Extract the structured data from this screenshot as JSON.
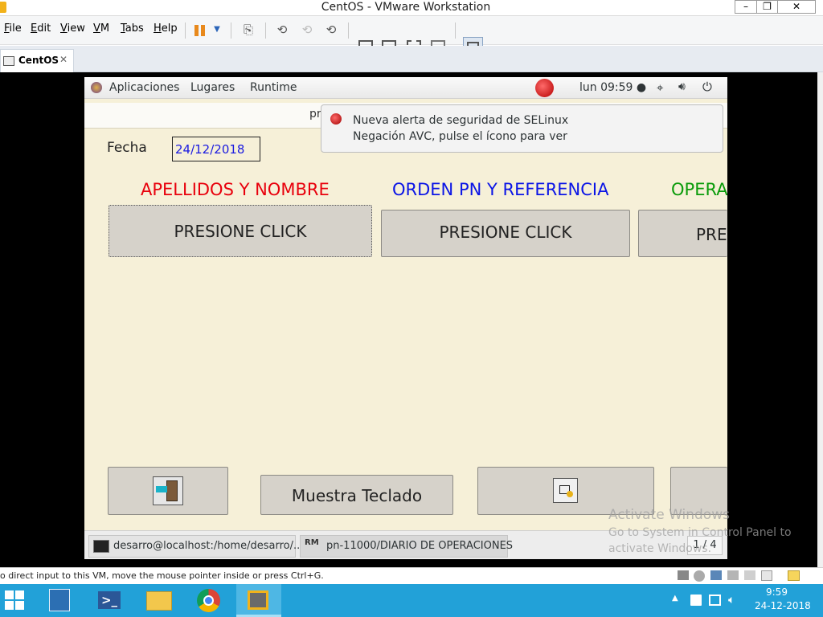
{
  "window": {
    "title": "CentOS - VMware Workstation",
    "minimize": "–",
    "maximize": "❐",
    "close": "✕"
  },
  "menubar": {
    "items": [
      {
        "label": "File",
        "key": "F",
        "rest": "ile"
      },
      {
        "label": "Edit",
        "key": "E",
        "rest": "dit"
      },
      {
        "label": "View",
        "key": "V",
        "rest": "iew"
      },
      {
        "label": "VM",
        "key": "V",
        "rest": "M"
      },
      {
        "label": "Tabs",
        "key": "T",
        "rest": "abs"
      },
      {
        "label": "Help",
        "key": "H",
        "rest": "elp"
      }
    ]
  },
  "tabs": [
    {
      "label": "CentOS",
      "close": "✕"
    }
  ],
  "gnome_panel": {
    "apps": "Aplicaciones",
    "places": "Lugares",
    "runtime": "Runtime",
    "clock": "lun 09:59 ●"
  },
  "app": {
    "header_fragment": "pr",
    "date_label": "Fecha",
    "date_value": "24/12/2018",
    "columns": [
      {
        "title": "APELLIDOS Y NOMBRE",
        "color": "#e8000c",
        "button": "PRESIONE CLICK"
      },
      {
        "title": "ORDEN PN Y REFERENCIA",
        "color": "#0a14e6",
        "button": "PRESIONE CLICK"
      },
      {
        "title": "OPERA",
        "color": "#0a9b0a",
        "button": "PRES"
      }
    ],
    "keyboard_button": "Muestra Teclado"
  },
  "notification": {
    "title": "Nueva alerta de seguridad de SELinux",
    "body": "Negación AVC, pulse el ícono para ver"
  },
  "gnome_bottom": {
    "task1": "desarro@localhost:/home/desarro/....",
    "task2": "pn-11000/DIARIO DE OPERACIONES",
    "workspace": "1 / 4"
  },
  "watermark": {
    "line1": "Activate Windows",
    "line2": "Go to System in Control Panel to",
    "line3": "activate Windows."
  },
  "vmware_status": {
    "text": "o direct input to this VM, move the mouse pointer inside or press Ctrl+G."
  },
  "win_taskbar": {
    "time": "9:59",
    "date": "24-12-2018"
  }
}
